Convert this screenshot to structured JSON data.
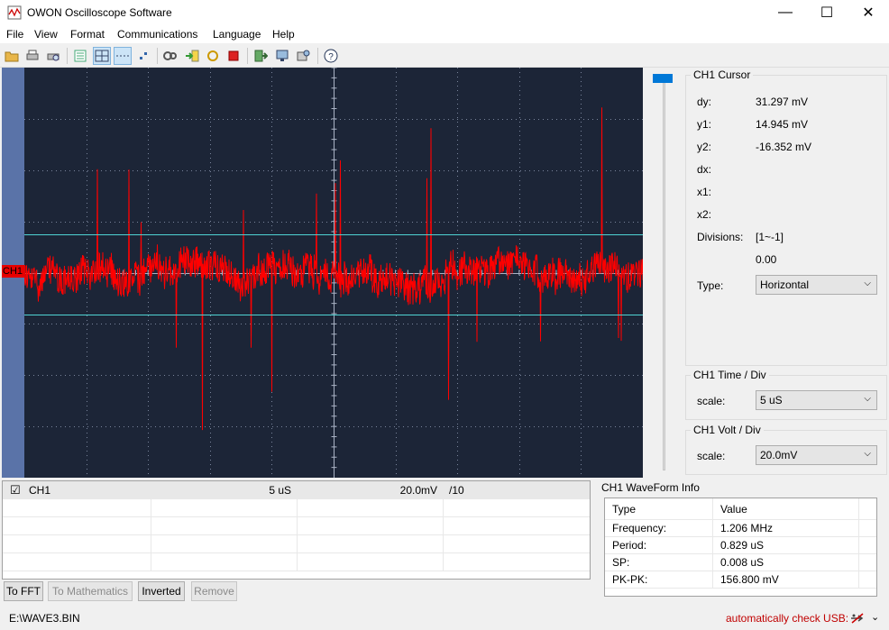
{
  "window": {
    "title": "OWON Oscilloscope Software",
    "minimize": "—",
    "maximize": "☐",
    "close": "✕"
  },
  "menu": [
    "File",
    "View",
    "Format",
    "Communications",
    "Language",
    "Help"
  ],
  "scope": {
    "channel_marker": "CH1",
    "trace_color": "#ff0000",
    "cursor_color": "#4fd3d3"
  },
  "cursor_panel": {
    "title": "CH1 Cursor",
    "dy_label": "dy:",
    "dy_value": "31.297 mV",
    "y1_label": "y1:",
    "y1_value": "14.945 mV",
    "y2_label": "y2:",
    "y2_value": "-16.352 mV",
    "dx_label": "dx:",
    "x1_label": "x1:",
    "x2_label": "x2:",
    "divisions_label": "Divisions:",
    "divisions_value": "[1~-1]",
    "divisions_num": "0.00",
    "type_label": "Type:",
    "type_value": "Horizontal"
  },
  "time_panel": {
    "title": "CH1 Time / Div",
    "scale_label": "scale:",
    "scale_value": "5  uS"
  },
  "volt_panel": {
    "title": "CH1 Volt / Div",
    "scale_label": "scale:",
    "scale_value": "20.0mV"
  },
  "channel_table": {
    "name": "CH1",
    "time": "5  uS",
    "volt": "20.0mV",
    "ratio": "/10",
    "checked": "☑"
  },
  "buttons": {
    "fft": "To FFT",
    "math": "To Mathematics",
    "inverted": "Inverted",
    "remove": "Remove"
  },
  "waveform_info": {
    "title": "CH1 WaveForm Info",
    "header_type": "Type",
    "header_value": "Value",
    "rows": [
      {
        "type": "Frequency:",
        "value": "1.206 MHz"
      },
      {
        "type": "Period:",
        "value": "0.829 uS"
      },
      {
        "type": "SP:",
        "value": "0.008 uS"
      },
      {
        "type": "PK-PK:",
        "value": "156.800 mV"
      }
    ]
  },
  "status": {
    "file": "E:\\WAVE3.BIN",
    "usb": "automatically check USB:"
  }
}
